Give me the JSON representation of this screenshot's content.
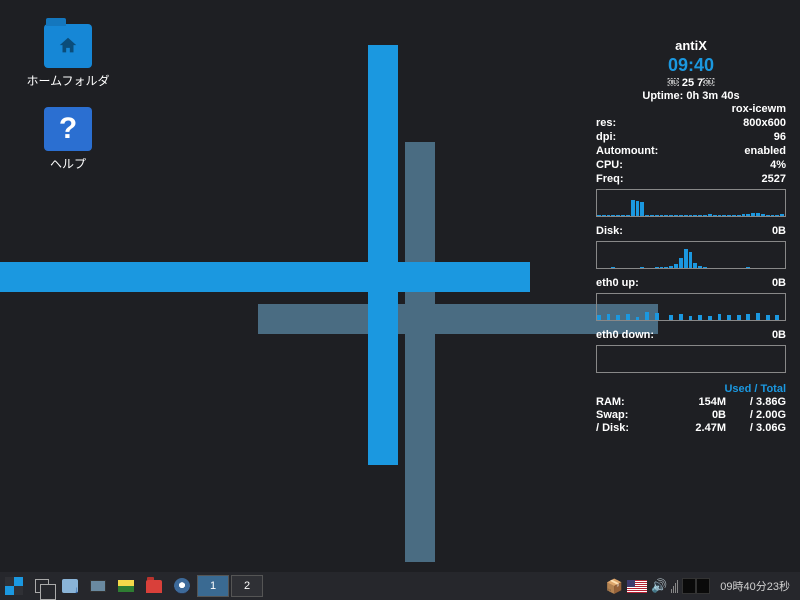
{
  "desktop": {
    "icons": [
      {
        "label": "ホームフォルダ",
        "name": "home-folder-icon"
      },
      {
        "label": "ヘルプ",
        "name": "help-icon"
      }
    ]
  },
  "conky": {
    "title": "antiX",
    "clock": "09:40",
    "date": "￼ 25  7￼",
    "uptime": "Uptime: 0h 3m 40s",
    "wm": "rox-icewm",
    "stats": {
      "res_label": "res:",
      "res_value": "800x600",
      "dpi_label": "dpi:",
      "dpi_value": "96",
      "automount_label": "Automount:",
      "automount_value": "enabled",
      "cpu_label": "CPU:",
      "cpu_value": "4%",
      "freq_label": "Freq:",
      "freq_value": "2527",
      "disk_label": "Disk:",
      "disk_value": "0B",
      "eth_up_label": "eth0 up:",
      "eth_up_value": "0B",
      "eth_dn_label": "eth0 down:",
      "eth_dn_value": "0B"
    },
    "mem": {
      "header": "Used / Total",
      "ram_label": "RAM:",
      "ram_used": "154M",
      "ram_total": "/ 3.86G",
      "swap_label": "Swap:",
      "swap_used": "0B",
      "swap_total": "/ 2.00G",
      "disk_label": "/ Disk:",
      "disk_used": "2.47M",
      "disk_total": "/ 3.06G"
    }
  },
  "taskbar": {
    "workspaces": [
      "1",
      "2"
    ],
    "active_workspace": 0,
    "clock": "09時40分23秒"
  },
  "chart_data": [
    {
      "type": "area",
      "title": "CPU history",
      "ylim": [
        0,
        100
      ],
      "values": [
        2,
        3,
        2,
        4,
        3,
        2,
        5,
        60,
        58,
        55,
        4,
        3,
        2,
        2,
        3,
        3,
        4,
        3,
        3,
        2,
        4,
        3,
        5,
        6,
        4,
        3,
        2,
        3,
        4,
        5,
        6,
        8,
        10,
        12,
        6,
        4,
        3,
        4,
        6
      ]
    },
    {
      "type": "area",
      "title": "Disk I/O",
      "ylim": [
        0,
        100
      ],
      "values": [
        1,
        1,
        1,
        2,
        1,
        0,
        0,
        1,
        0,
        2,
        1,
        1,
        3,
        2,
        4,
        8,
        16,
        40,
        72,
        60,
        20,
        6,
        2,
        1,
        1,
        1,
        1,
        0,
        1,
        0,
        1,
        2,
        1,
        0,
        0,
        0,
        1,
        1,
        1
      ]
    },
    {
      "type": "bar",
      "title": "eth0 up",
      "ylim": [
        0,
        100
      ],
      "values": [
        20,
        0,
        22,
        0,
        18,
        0,
        24,
        0,
        12,
        0,
        30,
        0,
        26,
        0,
        0,
        18,
        0,
        22,
        0,
        14,
        0,
        20,
        0,
        16,
        0,
        24,
        0,
        20,
        0,
        18,
        0,
        22,
        0,
        26,
        0,
        18,
        0,
        20,
        0
      ]
    },
    {
      "type": "area",
      "title": "eth0 down",
      "ylim": [
        0,
        100
      ],
      "values": [
        0,
        0,
        0,
        0,
        0,
        0,
        0,
        0,
        0,
        0,
        0,
        0,
        0,
        0,
        0,
        0,
        0,
        0,
        0,
        0,
        0,
        0,
        0,
        0,
        0,
        0,
        0,
        0,
        0,
        0,
        0,
        0,
        0,
        0,
        0,
        0,
        0,
        0,
        0
      ]
    }
  ]
}
